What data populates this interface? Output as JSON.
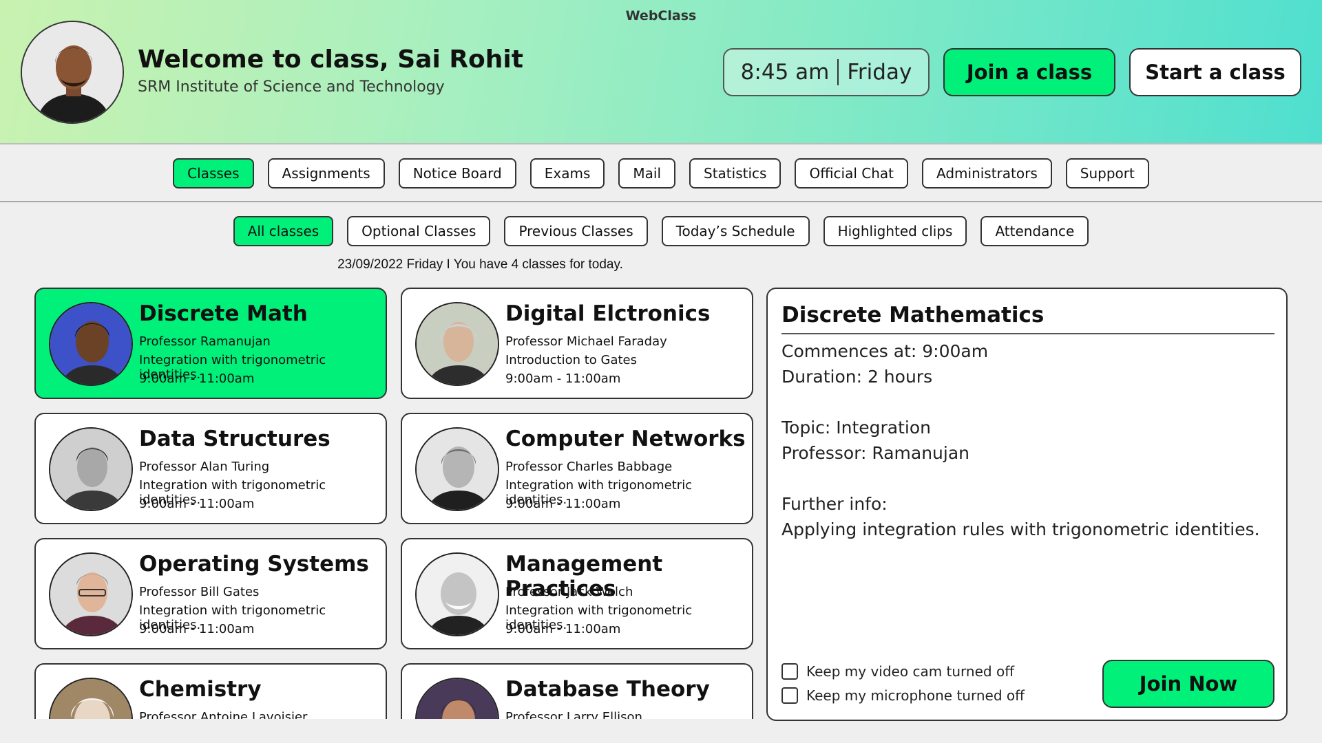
{
  "app": {
    "title": "WebClass"
  },
  "header": {
    "welcome": "Welcome to class, Sai Rohit",
    "institute": "SRM Institute of Science and Technology",
    "time": "8:45 am",
    "day": "Friday",
    "join_class_label": "Join a class",
    "start_class_label": "Start a class"
  },
  "nav": {
    "tabs": [
      "Classes",
      "Assignments",
      "Notice Board",
      "Exams",
      "Mail",
      "Statistics",
      "Official Chat",
      "Administrators",
      "Support"
    ],
    "active": "Classes"
  },
  "subnav": {
    "tabs": [
      "All classes",
      "Optional Classes",
      "Previous Classes",
      "Today’s Schedule",
      "Highlighted clips",
      "Attendance"
    ],
    "active": "All classes"
  },
  "date_line": "23/09/2022 Friday I You have 4 classes for today.",
  "classes": [
    {
      "name": "Discrete Math",
      "professor": "Professor Ramanujan",
      "topic": "Integration with trigonometric identities.",
      "time": "9:00am - 11:00am"
    },
    {
      "name": "Digital Elctronics",
      "professor": "Professor Michael Faraday",
      "topic": "Introduction to Gates",
      "time": "9:00am - 11:00am"
    },
    {
      "name": "Data Structures",
      "professor": "Professor Alan Turing",
      "topic": "Integration with trigonometric identities.",
      "time": "9:00am - 11:00am"
    },
    {
      "name": "Computer Networks",
      "professor": "Professor Charles Babbage",
      "topic": "Integration with trigonometric identities.",
      "time": "9:00am - 11:00am"
    },
    {
      "name": "Operating Systems",
      "professor": "Professor Bill Gates",
      "topic": "Integration with trigonometric identities.",
      "time": "9:00am - 11:00am"
    },
    {
      "name": "Management Practices",
      "professor": "Professor Jack Welch",
      "topic": "Integration with trigonometric identities.",
      "time": "9:00am - 11:00am"
    },
    {
      "name": "Chemistry",
      "professor": "Professor Antoine Lavoisier",
      "topic": "",
      "time": ""
    },
    {
      "name": "Database Theory",
      "professor": "Professor Larry Ellison",
      "topic": "",
      "time": ""
    }
  ],
  "selected_class": "Discrete Math",
  "detail": {
    "title": "Discrete Mathematics",
    "commences": "Commences at: 9:00am",
    "duration": "Duration: 2 hours",
    "topic": "Topic: Integration",
    "professor": "Professor: Ramanujan",
    "further_label": "Further info:",
    "further_text": "Applying integration rules with trigonometric identities.",
    "cam_off_label": "Keep my video cam turned off",
    "mic_off_label": "Keep my microphone turned off",
    "cam_off_checked": false,
    "mic_off_checked": false,
    "join_now_label": "Join Now"
  },
  "colors": {
    "accent": "#00f07a",
    "header_gradient_start": "#c9f2b0",
    "header_gradient_end": "#4fdfcf",
    "background": "#efefef"
  }
}
